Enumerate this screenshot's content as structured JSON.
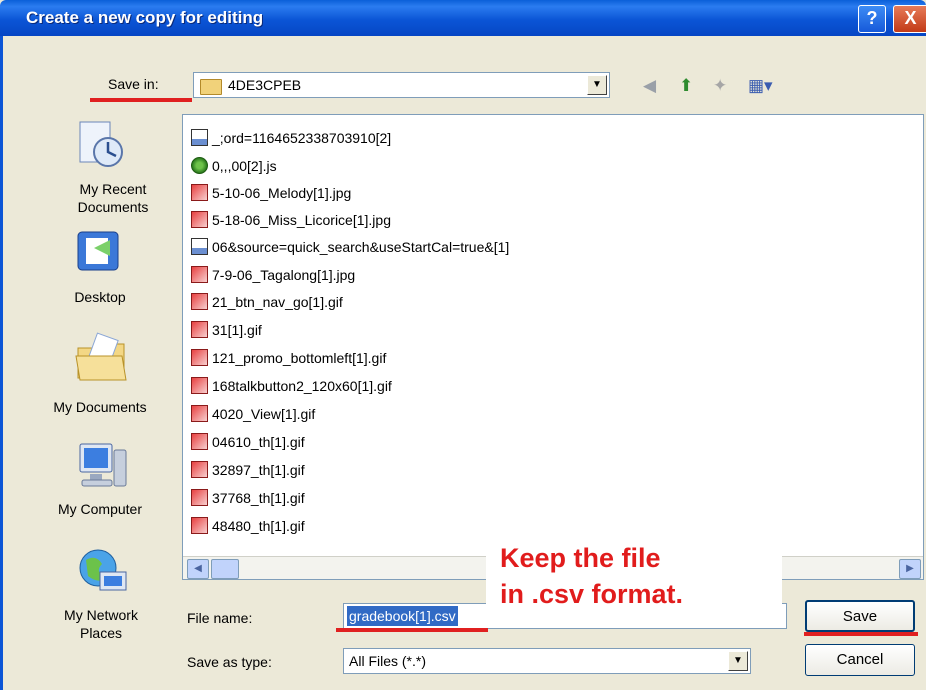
{
  "window": {
    "title": "Create a new copy for editing",
    "help_glyph": "?",
    "close_glyph": "X"
  },
  "savein": {
    "label": "Save in:",
    "folder": "4DE3CPEB",
    "dropdown_glyph": "▼"
  },
  "toolbar": {
    "back_glyph": "◀",
    "up_glyph": "⬆",
    "newfolder_glyph": "✦",
    "view_glyph": "▦▾"
  },
  "places": [
    {
      "label": "My Recent\nDocuments"
    },
    {
      "label": "Desktop"
    },
    {
      "label": "My Documents"
    },
    {
      "label": "My Computer"
    },
    {
      "label": "My Network\nPlaces"
    }
  ],
  "files": [
    {
      "name": "_;ord=1164652338703910[2]",
      "icon": "doc"
    },
    {
      "name": "0,,,00[2].js",
      "icon": "js"
    },
    {
      "name": "5-10-06_Melody[1].jpg",
      "icon": "img"
    },
    {
      "name": "5-18-06_Miss_Licorice[1].jpg",
      "icon": "img"
    },
    {
      "name": "06&source=quick_search&useStartCal=true&[1]",
      "icon": "doc"
    },
    {
      "name": "7-9-06_Tagalong[1].jpg",
      "icon": "img"
    },
    {
      "name": "21_btn_nav_go[1].gif",
      "icon": "img"
    },
    {
      "name": "31[1].gif",
      "icon": "img"
    },
    {
      "name": "121_promo_bottomleft[1].gif",
      "icon": "img"
    },
    {
      "name": "168talkbutton2_120x60[1].gif",
      "icon": "img"
    },
    {
      "name": "4020_View[1].gif",
      "icon": "img"
    },
    {
      "name": "04610_th[1].gif",
      "icon": "img"
    },
    {
      "name": "32897_th[1].gif",
      "icon": "img"
    },
    {
      "name": "37768_th[1].gif",
      "icon": "img"
    },
    {
      "name": "48480_th[1].gif",
      "icon": "img"
    }
  ],
  "scroll": {
    "left_glyph": "◀",
    "right_glyph": "▶"
  },
  "filename": {
    "label": "File name:",
    "value": "gradebook[1].csv"
  },
  "filetype": {
    "label": "Save as type:",
    "value": "All Files (*.*)",
    "dropdown_glyph": "▼"
  },
  "buttons": {
    "save": "Save",
    "cancel": "Cancel"
  },
  "callout": {
    "line1": "Keep the file",
    "line2": "in .csv format."
  },
  "colors": {
    "accent": "#0b55d6",
    "highlight": "#e02020",
    "selection": "#316ac5"
  }
}
